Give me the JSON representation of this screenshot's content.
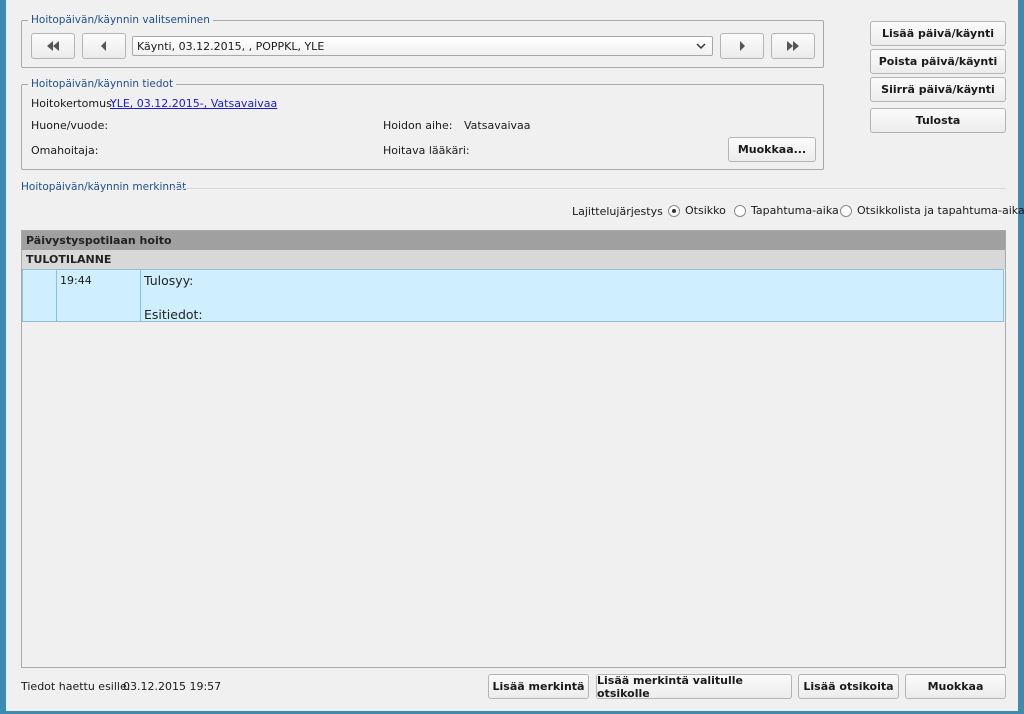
{
  "selection_group": {
    "legend": "Hoitopäivän/käynnin valitseminen",
    "visit_select_value": "Käynti, 03.12.2015, , POPPKL, YLE"
  },
  "details_group": {
    "legend": "Hoitopäivän/käynnin tiedot",
    "hoitokertomus_label": "Hoitokertomus:",
    "hoitokertomus_link": "YLE, 03.12.2015-, Vatsavaivaa",
    "huone_label": "Huone/vuode:",
    "omahoitaja_label": "Omahoitaja:",
    "hoidon_aihe_label": "Hoidon aihe:",
    "hoidon_aihe_value": "Vatsavaivaa",
    "hoitava_laakari_label": "Hoitava lääkäri:",
    "edit_button": "Muokkaa..."
  },
  "side_buttons": {
    "add": "Lisää päivä/käynti",
    "remove": "Poista päivä/käynti",
    "move": "Siirrä päivä/käynti",
    "print": "Tulosta"
  },
  "entries": {
    "title": "Hoitopäivän/käynnin merkinnät",
    "sort_label": "Lajittelujärjestys",
    "sort_options": [
      "Otsikko",
      "Tapahtuma-aika",
      "Otsikkolista ja tapahtuma-aika"
    ],
    "sort_selected": "Otsikko",
    "group_header": "Päivystyspotilaan hoito",
    "sub_header": "TULOTILANNE",
    "rows": [
      {
        "time": "19:44",
        "lines": [
          "Tulosyy:",
          "",
          "Esitiedot:"
        ]
      }
    ]
  },
  "footer": {
    "fetched_label": "Tiedot haettu esille:",
    "fetched_value": "03.12.2015 19:57",
    "add_entry": "Lisää merkintä",
    "add_entry_selected": "Lisää merkintä valitulle otsikolle",
    "add_headings": "Lisää otsikoita",
    "edit": "Muokkaa"
  },
  "colors": {
    "frame": "#3f8ab0",
    "legend_text": "#1f4e8c",
    "row_highlight": "#cfefff",
    "group_header_bg": "#a0a0a0"
  }
}
